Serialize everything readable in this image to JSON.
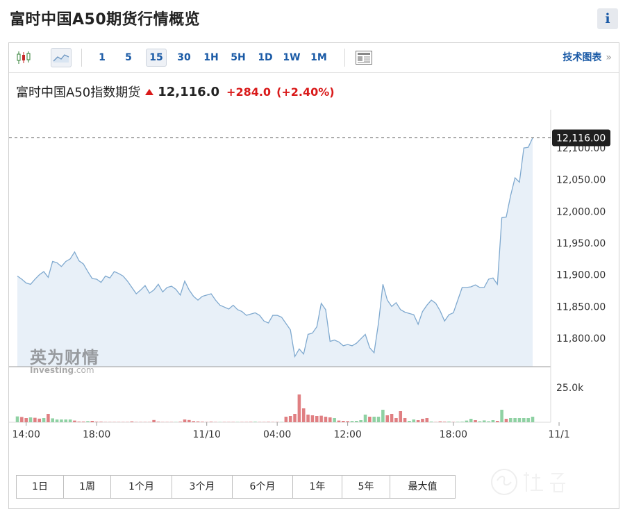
{
  "page": {
    "title": "富时中国A50期货行情概览",
    "info_label": "i"
  },
  "toolbar": {
    "chart_type_icons": [
      {
        "name": "candlestick-icon",
        "selected": false
      },
      {
        "name": "area-chart-icon",
        "selected": true
      }
    ],
    "timeframes": [
      "1",
      "5",
      "15",
      "30",
      "1H",
      "5H",
      "1D",
      "1W",
      "1M"
    ],
    "active_timeframe": "15",
    "news_icon": "news-icon",
    "tech_chart_label": "技术图表",
    "tech_chart_chevron": "»"
  },
  "quote": {
    "name": "富时中国A50指数期货",
    "price": "12,116.0",
    "change": "+284.0",
    "change_pct": "(+2.40%)",
    "direction": "up",
    "color_up": "#d91a1a"
  },
  "watermark": {
    "cn": "英为财情",
    "en": "Investing",
    "en_suffix": ".com"
  },
  "range_buttons": [
    "1日",
    "1周",
    "1个月",
    "3个月",
    "6个月",
    "1年",
    "5年",
    "最大值"
  ],
  "colors": {
    "line": "#7fa9cf",
    "area": "#e8f0f8",
    "vol_up": "#8fd1a3",
    "vol_down": "#e07f82",
    "last_tag_bg": "#1f1f1f",
    "link_blue": "#1a5aa6"
  },
  "chart_data": {
    "type": "area",
    "y_ticks": [
      "12,100.00",
      "12,050.00",
      "12,000.00",
      "11,950.00",
      "11,900.00",
      "11,850.00",
      "11,800.00"
    ],
    "y_tick_values": [
      12100,
      12050,
      12000,
      11950,
      11900,
      11850,
      11800
    ],
    "ylim": [
      11755,
      12145
    ],
    "x_ticks": [
      {
        "label": "14:00",
        "index": 2
      },
      {
        "label": "18:00",
        "index": 18
      },
      {
        "label": "11/10",
        "index": 43
      },
      {
        "label": "04:00",
        "index": 59
      },
      {
        "label": "12:00",
        "index": 75
      },
      {
        "label": "18:00",
        "index": 99
      },
      {
        "label": "11/1",
        "index": 123
      }
    ],
    "last_value_label": "12,116.00",
    "last_value": 12116,
    "close": [
      11898,
      11893,
      11887,
      11885,
      11893,
      11900,
      11905,
      11896,
      11921,
      11919,
      11913,
      11921,
      11925,
      11936,
      11922,
      11917,
      11905,
      11894,
      11893,
      11888,
      11898,
      11895,
      11905,
      11902,
      11898,
      11890,
      11880,
      11870,
      11876,
      11883,
      11871,
      11876,
      11885,
      11873,
      11880,
      11882,
      11877,
      11868,
      11890,
      11876,
      11866,
      11860,
      11866,
      11868,
      11870,
      11860,
      11852,
      11849,
      11846,
      11852,
      11845,
      11842,
      11836,
      11838,
      11840,
      11836,
      11827,
      11824,
      11836,
      11836,
      11833,
      11823,
      11813,
      11771,
      11783,
      11775,
      11806,
      11808,
      11818,
      11855,
      11845,
      11795,
      11797,
      11794,
      11788,
      11790,
      11788,
      11792,
      11799,
      11806,
      11785,
      11777,
      11824,
      11885,
      11860,
      11850,
      11856,
      11845,
      11841,
      11839,
      11837,
      11822,
      11842,
      11852,
      11860,
      11855,
      11843,
      11827,
      11837,
      11840,
      11860,
      11880,
      11880,
      11881,
      11884,
      11880,
      11880,
      11893,
      11895,
      11885,
      11990,
      11991,
      12025,
      12053,
      12046,
      12100,
      12101,
      12116
    ],
    "volume_ticks": [
      "25.0k"
    ],
    "volume_tick_values": [
      25000
    ],
    "volume_max": 32000,
    "volume": [
      4200,
      3800,
      3000,
      3500,
      3200,
      2600,
      3000,
      6000,
      2800,
      2000,
      2000,
      2000,
      2000,
      1200,
      500,
      500,
      800,
      1000,
      400,
      400,
      200,
      200,
      200,
      200,
      200,
      200,
      600,
      200,
      200,
      200,
      200,
      1600,
      400,
      200,
      200,
      200,
      200,
      400,
      2000,
      1600,
      800,
      600,
      400,
      200,
      400,
      200,
      200,
      200,
      200,
      200,
      200,
      200,
      200,
      300,
      400,
      200,
      200,
      300,
      200,
      200,
      200,
      4000,
      4500,
      6000,
      20000,
      10000,
      5500,
      5000,
      4500,
      4700,
      4000,
      3500,
      3000,
      1200,
      1000,
      800,
      900,
      1000,
      1500,
      5500,
      4000,
      4000,
      4000,
      9000,
      5000,
      6000,
      3000,
      8000,
      3000,
      1000,
      2000,
      1500,
      2500,
      3000,
      500,
      200,
      600,
      400,
      500,
      200,
      300,
      400,
      1200,
      2500,
      1500,
      700,
      1300,
      700,
      1500,
      1000,
      9000,
      2500,
      3000,
      3000,
      3000,
      3000,
      3000,
      4000
    ],
    "volume_up": [
      1,
      0,
      0,
      1,
      0,
      0,
      1,
      0,
      1,
      1,
      1,
      1,
      1,
      0,
      0,
      0,
      1,
      0,
      0,
      0,
      0,
      0,
      0,
      0,
      0,
      0,
      0,
      0,
      0,
      0,
      0,
      0,
      0,
      0,
      0,
      0,
      1,
      0,
      0,
      0,
      0,
      0,
      0,
      0,
      0,
      0,
      1,
      0,
      0,
      0,
      1,
      0,
      0,
      0,
      1,
      0,
      0,
      0,
      0,
      0,
      1,
      0,
      0,
      0,
      0,
      0,
      0,
      0,
      0,
      0,
      0,
      0,
      1,
      0,
      0,
      0,
      1,
      1,
      1,
      1,
      0,
      1,
      1,
      1,
      0,
      0,
      0,
      0,
      0,
      1,
      1,
      0,
      0,
      0,
      1,
      0,
      0,
      0,
      1,
      0,
      1,
      1,
      1,
      1,
      0,
      1,
      1,
      1,
      1,
      0,
      1,
      0,
      1,
      1,
      1,
      1,
      1,
      1
    ]
  }
}
